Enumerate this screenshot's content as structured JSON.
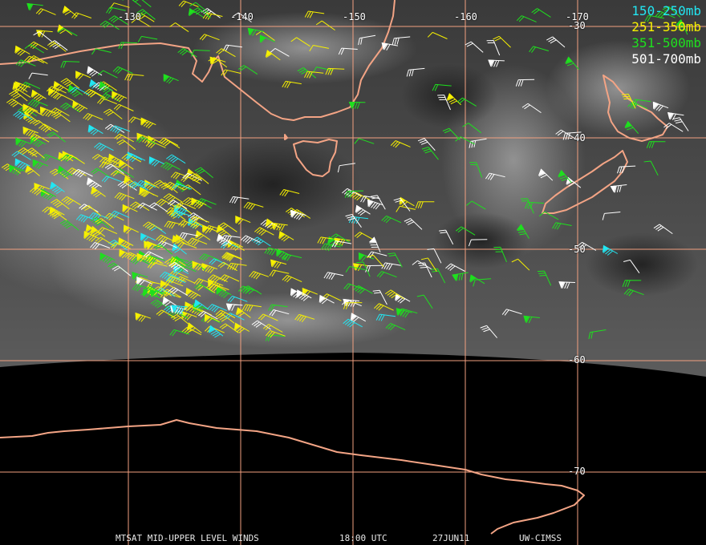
{
  "map": {
    "longitude_labels": [
      "-130",
      "-140",
      "-150",
      "-160",
      "-170"
    ],
    "latitude_labels": [
      "-30",
      "-40",
      "-50",
      "-60",
      "-70"
    ],
    "graticule_color": "#f2a080",
    "coastline_color": "#f3a485"
  },
  "legend": [
    {
      "label": "150-250mb",
      "color": "#22e6f2"
    },
    {
      "label": "251-350mb",
      "color": "#f6f000"
    },
    {
      "label": "351-500mb",
      "color": "#1ee01e"
    },
    {
      "label": "501-700mb",
      "color": "#ffffff"
    }
  ],
  "footer": {
    "product": "MTSAT MID-UPPER LEVEL WINDS",
    "time": "18:00 UTC",
    "date": "27JUN11",
    "source": "UW-CIMSS"
  }
}
